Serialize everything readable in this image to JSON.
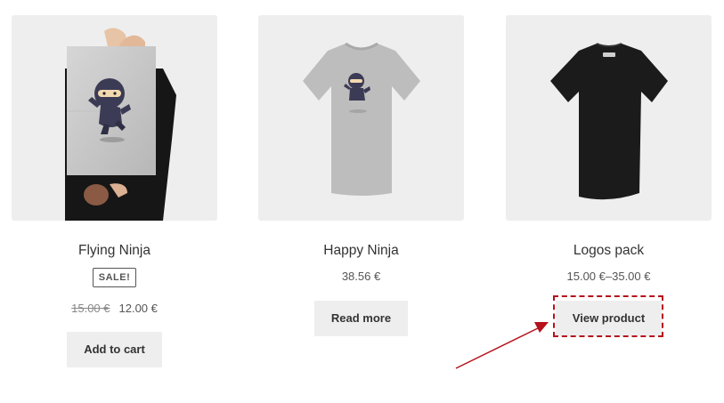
{
  "products": [
    {
      "title": "Flying Ninja",
      "badge": "SALE!",
      "old_price": "15.00 €",
      "price": "12.00 €",
      "button": "Add to cart",
      "image_icon": "poster-ninja-icon"
    },
    {
      "title": "Happy Ninja",
      "price": "38.56 €",
      "button": "Read more",
      "image_icon": "grey-tshirt-ninja-icon"
    },
    {
      "title": "Logos pack",
      "price": "15.00 €–35.00 €",
      "button": "View product",
      "image_icon": "black-tshirt-back-icon"
    }
  ],
  "annotation": {
    "color": "#b5121b"
  },
  "colors": {
    "thumb_bg": "#eeeeee",
    "button_bg": "#eeeeee",
    "text": "#333333"
  }
}
